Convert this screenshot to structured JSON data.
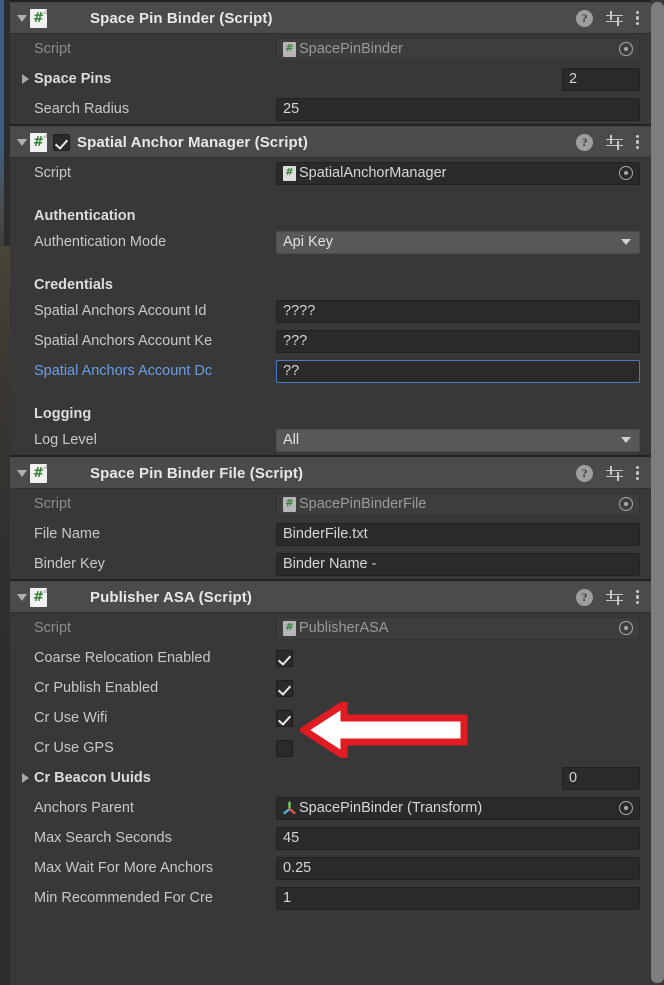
{
  "window": {
    "title": "Unity Inspector"
  },
  "icons": {
    "help": "?",
    "hash": "#",
    "preset": "preset-icon",
    "menu": "kebab-menu-icon"
  },
  "components": [
    {
      "id": "space-pin-binder",
      "title": "Space Pin Binder (Script)",
      "expanded": true,
      "has_enable_toggle": false,
      "rows": [
        {
          "kind": "object",
          "label": "Script",
          "value": "SpacePinBinder",
          "readonly": true
        },
        {
          "kind": "foldout-count",
          "label": "Space Pins",
          "value": "2",
          "expanded": false
        },
        {
          "kind": "text",
          "label": "Search Radius",
          "value": "25"
        }
      ]
    },
    {
      "id": "spatial-anchor-manager",
      "title": "Spatial Anchor Manager (Script)",
      "expanded": true,
      "has_enable_toggle": true,
      "enabled": true,
      "rows": [
        {
          "kind": "object",
          "label": "Script",
          "value": "SpatialAnchorManager",
          "readonly": false
        },
        {
          "kind": "gap"
        },
        {
          "kind": "section",
          "label": "Authentication"
        },
        {
          "kind": "dropdown",
          "label": "Authentication Mode",
          "value": "Api Key"
        },
        {
          "kind": "gap"
        },
        {
          "kind": "section",
          "label": "Credentials"
        },
        {
          "kind": "text",
          "label": "Spatial Anchors Account Id",
          "value": "????"
        },
        {
          "kind": "text",
          "label": "Spatial Anchors Account Ke",
          "value": "???"
        },
        {
          "kind": "text",
          "label": "Spatial Anchors Account Dc",
          "value": "??",
          "label_highlight": true,
          "focused": true
        },
        {
          "kind": "gap"
        },
        {
          "kind": "section",
          "label": "Logging"
        },
        {
          "kind": "dropdown",
          "label": "Log Level",
          "value": "All"
        }
      ]
    },
    {
      "id": "space-pin-binder-file",
      "title": "Space Pin Binder File (Script)",
      "expanded": true,
      "has_enable_toggle": false,
      "rows": [
        {
          "kind": "object",
          "label": "Script",
          "value": "SpacePinBinderFile",
          "readonly": true
        },
        {
          "kind": "text",
          "label": "File Name",
          "value": "BinderFile.txt"
        },
        {
          "kind": "text",
          "label": "Binder Key",
          "value": "Binder Name -"
        }
      ]
    },
    {
      "id": "publisher-asa",
      "title": "Publisher ASA (Script)",
      "expanded": true,
      "has_enable_toggle": false,
      "rows": [
        {
          "kind": "object",
          "label": "Script",
          "value": "PublisherASA",
          "readonly": true
        },
        {
          "kind": "checkbox",
          "label": "Coarse Relocation Enabled",
          "checked": true
        },
        {
          "kind": "checkbox",
          "label": "Cr Publish Enabled",
          "checked": true
        },
        {
          "kind": "checkbox",
          "label": "Cr Use Wifi",
          "checked": true
        },
        {
          "kind": "checkbox",
          "label": "Cr Use GPS",
          "checked": false
        },
        {
          "kind": "foldout-count",
          "label": "Cr Beacon Uuids",
          "value": "0",
          "expanded": false
        },
        {
          "kind": "object-transform",
          "label": "Anchors Parent",
          "value": "SpacePinBinder (Transform)"
        },
        {
          "kind": "text",
          "label": "Max Search Seconds",
          "value": "45"
        },
        {
          "kind": "text",
          "label": "Max Wait For More Anchors",
          "value": "0.25"
        },
        {
          "kind": "text",
          "label": "Min Recommended For Cre",
          "value": "1"
        }
      ]
    }
  ],
  "annotation": {
    "type": "arrow-left",
    "color": "#e01b22",
    "fill": "#ffffff",
    "points_at": "Coarse Relocation Enabled"
  },
  "colors": {
    "panel_bg": "#383838",
    "header_bg": "#4b4b4b",
    "field_bg": "#2a2a2a",
    "accent_blue": "#6b9ee8",
    "script_green": "#2f7d32"
  }
}
